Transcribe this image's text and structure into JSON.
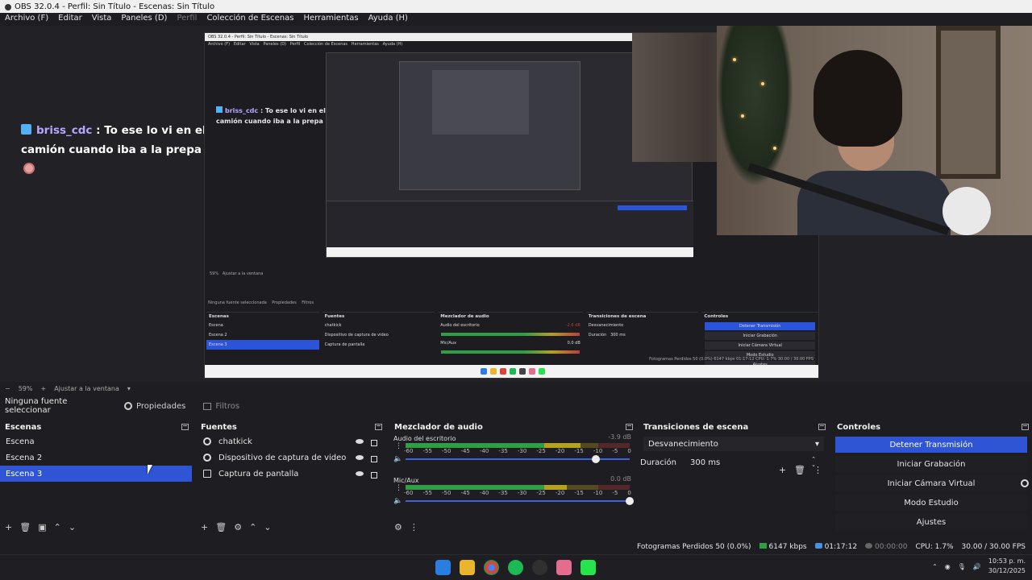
{
  "window": {
    "title": "OBS 32.0.4 - Perfil: Sin Título - Escenas: Sin Título"
  },
  "menu": [
    {
      "label": "Archivo (F)",
      "enabled": true
    },
    {
      "label": "Editar",
      "enabled": true
    },
    {
      "label": "Vista",
      "enabled": true
    },
    {
      "label": "Paneles (D)",
      "enabled": true
    },
    {
      "label": "Perfil",
      "enabled": false
    },
    {
      "label": "Colección de Escenas",
      "enabled": true
    },
    {
      "label": "Herramientas",
      "enabled": true
    },
    {
      "label": "Ayuda (H)",
      "enabled": true
    }
  ],
  "preview": {
    "chat": {
      "username": "briss_cdc",
      "message_line1": " : To ese lo vi en el",
      "message_line2": "camión cuando iba a la prepa"
    },
    "nested": {
      "chat_username": "briss_cdc",
      "chat_line1": " : To ese lo vi en el",
      "chat_line2": "camión cuando iba a la prepa",
      "scenes_header": "Escenas",
      "sources_header": "Fuentes",
      "mixer_header": "Mezclador de audio",
      "transitions_header": "Transiciones de escena",
      "controls_header": "Controles",
      "no_source": "Ninguna fuente seleccionada",
      "properties": "Propiedades",
      "filters": "Filtros",
      "scenes": [
        "Escena",
        "Escena 2",
        "Escena 3"
      ],
      "sources": [
        "chatkick",
        "Dispositivo de captura de video",
        "Captura de pantalla"
      ],
      "mixer_channels": [
        {
          "name": "Audio del escritorio",
          "db": "-2.6 dB"
        },
        {
          "name": "Mic/Aux",
          "db": "0.0 dB"
        }
      ],
      "transition": "Desvanecimiento",
      "duration_label": "Duración",
      "duration": "300 ms",
      "controls": [
        "Detener Transmisión",
        "Iniciar Grabación",
        "Iniciar Cámara Virtual",
        "Modo Estudio",
        "Ajustes"
      ],
      "status": "Fotogramas Perdidos 50 (0.0%)   6147 kbps   01:17:12   CPU: 1.7%   30.00 / 30.00 FPS",
      "toolbar_zoom": "59%",
      "toolbar_fit": "Ajustar a la ventana"
    }
  },
  "preview_toolbar": {
    "zoom": "59%",
    "fit": "Ajustar a la ventana"
  },
  "source_bar": {
    "no_source": "Ninguna fuente seleccionar",
    "properties": "Propiedades",
    "filters": "Filtros"
  },
  "docks": {
    "scenes": {
      "title": "Escenas",
      "items": [
        "Escena",
        "Escena 2",
        "Escena 3"
      ],
      "selected_index": 2
    },
    "sources": {
      "title": "Fuentes",
      "items": [
        {
          "label": "chatkick",
          "icon": "camera-icon"
        },
        {
          "label": "Dispositivo de captura de video",
          "icon": "camera-icon"
        },
        {
          "label": "Captura de pantalla",
          "icon": "display-icon"
        }
      ]
    },
    "mixer": {
      "title": "Mezclador de audio",
      "channels": [
        {
          "name": "Audio del escritorio",
          "db": "-3.9 dB",
          "level": 0.78,
          "volume": 0.85
        },
        {
          "name": "Mic/Aux",
          "db": "0.0 dB",
          "level": 0.72,
          "volume": 1.0
        }
      ],
      "ticks": [
        "-60",
        "-55",
        "-50",
        "-45",
        "-40",
        "-35",
        "-30",
        "-25",
        "-20",
        "-15",
        "-10",
        "-5",
        "0"
      ]
    },
    "transitions": {
      "title": "Transiciones de escena",
      "selected": "Desvanecimiento",
      "duration_label": "Duración",
      "duration_value": "300 ms"
    },
    "controls": {
      "title": "Controles",
      "buttons": [
        {
          "label": "Detener Transmisión",
          "primary": true
        },
        {
          "label": "Iniciar Grabación",
          "primary": false
        },
        {
          "label": "Iniciar Cámara Virtual",
          "primary": false
        },
        {
          "label": "Modo Estudio",
          "primary": false
        },
        {
          "label": "Ajustes",
          "primary": false
        }
      ]
    }
  },
  "status": {
    "dropped_frames": "Fotogramas Perdidos 50 (0.0%)",
    "bitrate": "6147 kbps",
    "stream_time": "01:17:12",
    "rec_time": "00:00:00",
    "cpu": "CPU: 1.7%",
    "fps": "30.00 / 30.00 FPS"
  },
  "taskbar": {
    "time": "10:53 p. m.",
    "date": "30/12/2025"
  },
  "colors": {
    "accent": "#2f55d4",
    "background": "#1e1e22",
    "meter_green": "#2ea043",
    "meter_yellow": "#b6a11b",
    "meter_red": "#c13a3a"
  }
}
